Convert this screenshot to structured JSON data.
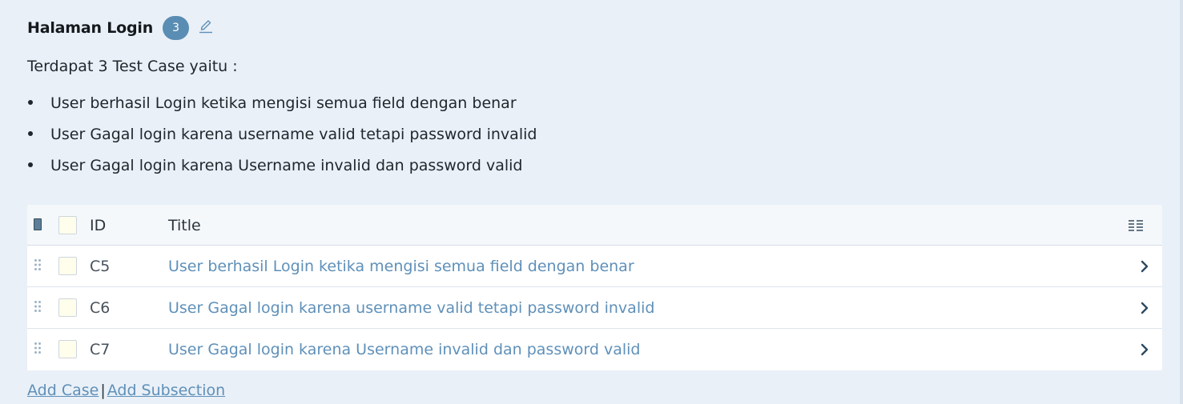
{
  "section": {
    "title": "Halaman Login",
    "count": "3"
  },
  "description": "Terdapat 3 Test Case yaitu :",
  "bullets": [
    "User berhasil Login ketika mengisi semua field dengan benar",
    "User Gagal login karena username valid tetapi password invalid",
    "User Gagal login karena Username invalid dan password valid"
  ],
  "table": {
    "headers": {
      "id": "ID",
      "title": "Title"
    },
    "rows": [
      {
        "id": "C5",
        "title": "User berhasil Login ketika mengisi semua field dengan benar"
      },
      {
        "id": "C6",
        "title": "User Gagal login karena username valid tetapi password invalid"
      },
      {
        "id": "C7",
        "title": "User Gagal login karena Username invalid dan password valid"
      }
    ]
  },
  "footer": {
    "add_case": "Add Case",
    "separator": "|",
    "add_subsection": "Add Subsection"
  },
  "colors": {
    "background": "#e9f0f7",
    "badge": "#5a8db3",
    "link": "#5f90b9",
    "checkbox_fill": "#fffdeb"
  },
  "icons": {
    "edit": "pencil-icon",
    "columns": "columns-icon",
    "drag": "drag-handle-icon",
    "row_open": "chevron-right-icon"
  }
}
